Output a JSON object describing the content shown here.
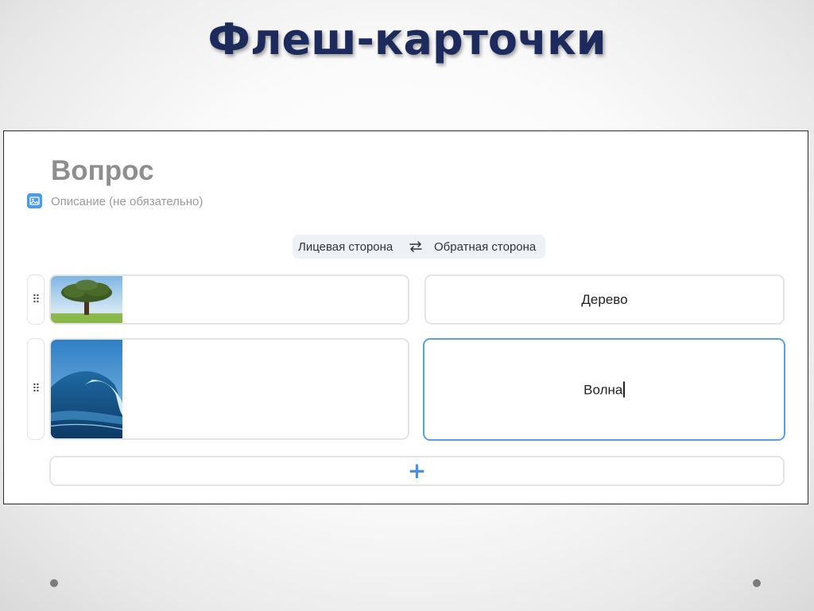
{
  "slide": {
    "title": "Флеш-карточки"
  },
  "question": {
    "title": "Вопрос",
    "description_placeholder": "Описание (не обязательно)"
  },
  "sides": {
    "front_label": "Лицевая сторона",
    "back_label": "Обратная сторона"
  },
  "cards": [
    {
      "front_image": "tree-photo",
      "back_text": "Дерево",
      "active": false
    },
    {
      "front_image": "wave-photo",
      "back_text": "Волна",
      "active": true
    }
  ],
  "add_button": {
    "symbol": "+"
  },
  "colors": {
    "title": "#1d2a5c",
    "accent": "#4a8fe0",
    "active_border": "#5aa0e6"
  }
}
